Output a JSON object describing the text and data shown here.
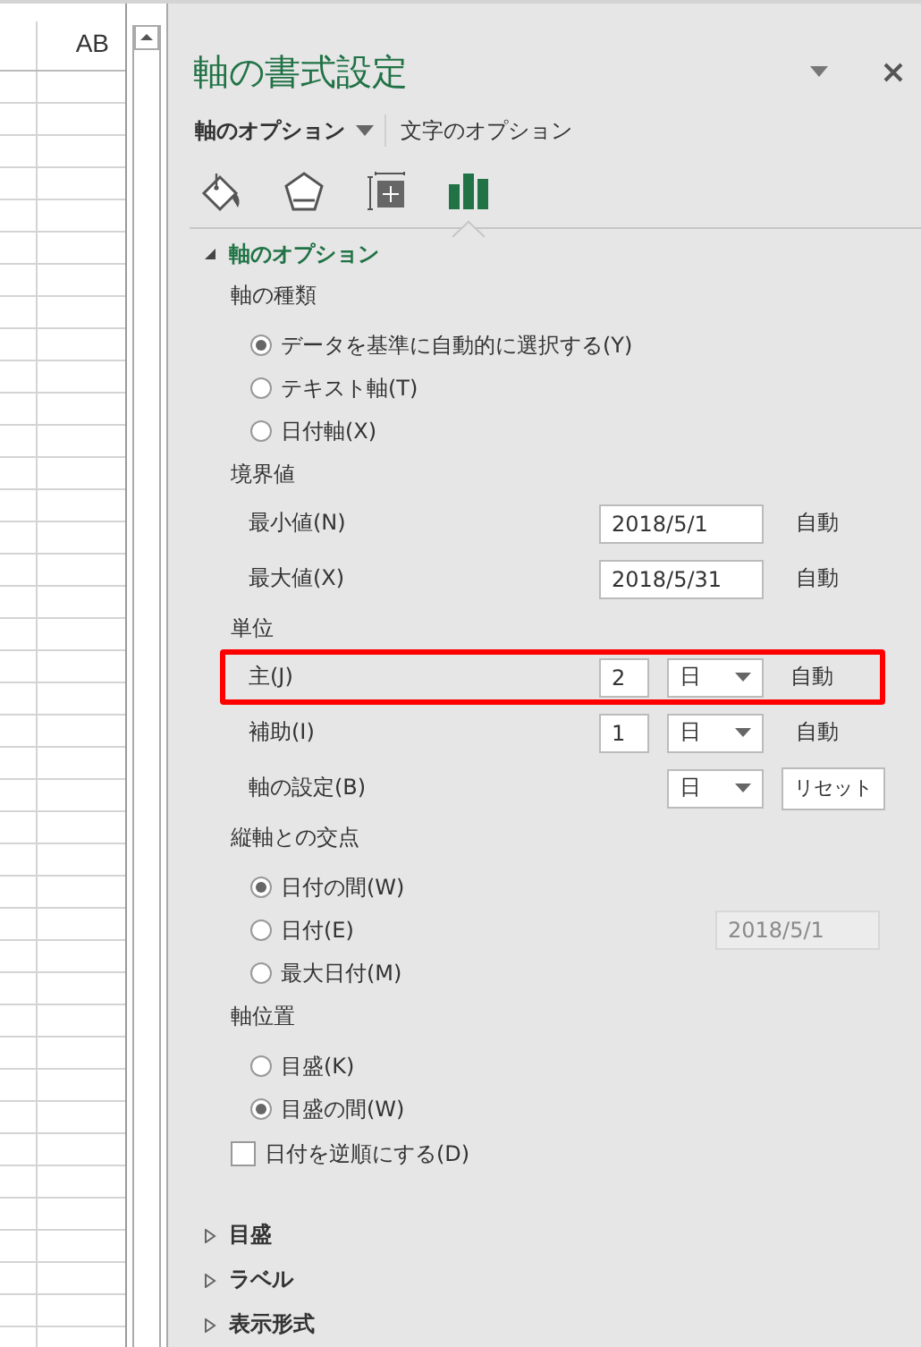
{
  "sheet": {
    "column_header": "AB"
  },
  "panel": {
    "title": "軸の書式設定",
    "tabs": [
      {
        "label": "軸のオプション",
        "selected": true,
        "kind": "dropdown"
      },
      {
        "label": "文字のオプション",
        "selected": false,
        "kind": "plain"
      }
    ],
    "icon_tabs": [
      {
        "kind": "fill",
        "selected": false
      },
      {
        "kind": "effects",
        "selected": false
      },
      {
        "kind": "size",
        "selected": false
      },
      {
        "kind": "options",
        "selected": true
      }
    ],
    "sections": [
      {
        "title": "軸のオプション",
        "expanded": true,
        "groups": [
          {
            "heading": "軸の種類",
            "items": [
              {
                "kind": "radio",
                "label": "データを基準に自動的に選択する(Y)",
                "selected": true
              },
              {
                "kind": "radio",
                "label": "テキスト軸(T)",
                "selected": false
              },
              {
                "kind": "radio",
                "label": "日付軸(X)",
                "selected": false
              }
            ]
          },
          {
            "heading": "境界値",
            "items": [
              {
                "kind": "value",
                "label": "最小値(N)",
                "value": "2018/5/1",
                "auto": "自動"
              },
              {
                "kind": "value",
                "label": "最大値(X)",
                "value": "2018/5/31",
                "auto": "自動"
              }
            ]
          },
          {
            "heading": "単位",
            "items": [
              {
                "kind": "unit",
                "label": "主(J)",
                "value": "2",
                "unit": "日",
                "auto": "自動",
                "highlighted": true
              },
              {
                "kind": "unit",
                "label": "補助(I)",
                "value": "1",
                "unit": "日",
                "auto": "自動",
                "highlighted": false
              },
              {
                "kind": "reset",
                "label": "軸の設定(B)",
                "unit": "日",
                "button": "リセット"
              }
            ]
          },
          {
            "heading": "縦軸との交点",
            "items": [
              {
                "kind": "radio",
                "label": "日付の間(W)",
                "selected": true
              },
              {
                "kind": "radio",
                "label": "日付(E)",
                "selected": false,
                "value": "2018/5/1",
                "disabled": true
              },
              {
                "kind": "radio",
                "label": "最大日付(M)",
                "selected": false
              }
            ]
          },
          {
            "heading": "軸位置",
            "items": [
              {
                "kind": "radio",
                "label": "目盛(K)",
                "selected": false
              },
              {
                "kind": "radio",
                "label": "目盛の間(W)",
                "selected": true
              },
              {
                "kind": "checkbox",
                "label": "日付を逆順にする(D)",
                "checked": false
              }
            ]
          }
        ]
      },
      {
        "title": "目盛",
        "expanded": false
      },
      {
        "title": "ラベル",
        "expanded": false
      },
      {
        "title": "表示形式",
        "expanded": false
      }
    ]
  }
}
